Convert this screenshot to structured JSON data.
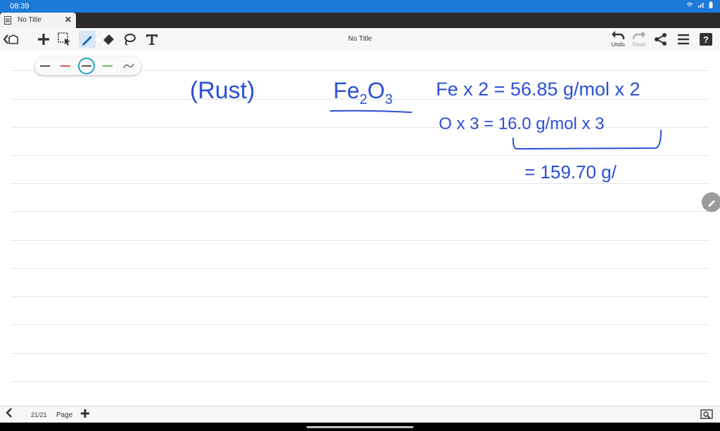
{
  "status": {
    "time": "08:39"
  },
  "tab": {
    "title": "No Title"
  },
  "toolbar": {
    "doc_title": "No Title",
    "undo_label": "Undo",
    "redo_label": "Redo",
    "tools": [
      "back-icon",
      "add-icon",
      "select-icon",
      "pen-icon",
      "eraser-icon",
      "lasso-icon",
      "text-icon"
    ],
    "accent": "#1d7ad6"
  },
  "pens": [
    {
      "color": "#555555"
    },
    {
      "color": "#e05a4f"
    },
    {
      "color": "#22a3c3",
      "selected": true
    },
    {
      "color": "#5fb865"
    },
    {
      "color": "#555555",
      "kind": "curve"
    }
  ],
  "notes": {
    "rust": "(Rust)",
    "formula": "Fe2O3",
    "line1": "Fe x 2 = 56.85 g/mol x 2",
    "line2": "O x 3 = 16.0 g/mol x 3",
    "line3": "= 159.70 g/"
  },
  "bottom": {
    "page_count": "21/21",
    "page_label": "Page"
  }
}
